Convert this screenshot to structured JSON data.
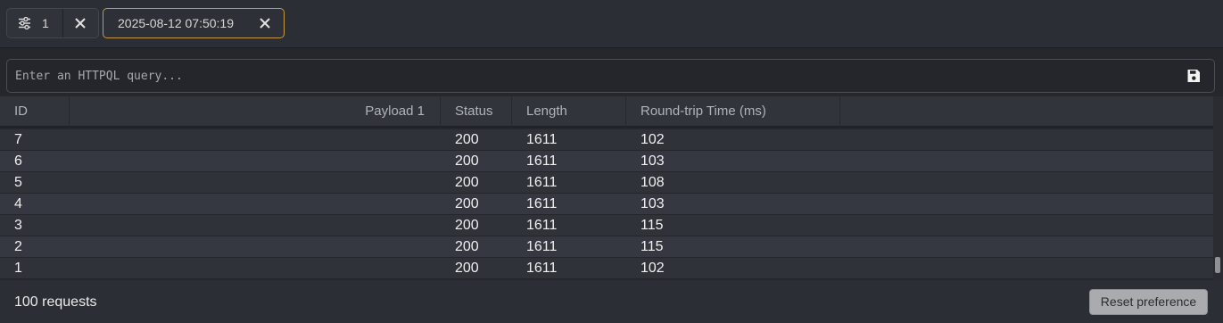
{
  "tabs": [
    {
      "icon": "filter-sliders-icon",
      "label": "1",
      "close_icon": "close-icon"
    },
    {
      "label": "2025-08-12 07:50:19",
      "close_icon": "close-icon",
      "active": true,
      "accent": "#c69a3e"
    }
  ],
  "query": {
    "placeholder": "Enter an HTTPQL query...",
    "value": "",
    "save_icon": "save-icon"
  },
  "table": {
    "columns": [
      "ID",
      "Payload 1",
      "Status",
      "Length",
      "Round-trip Time (ms)"
    ],
    "rows": [
      {
        "id": "7",
        "payload": "",
        "status": "200",
        "length": "1611",
        "rtt": "102"
      },
      {
        "id": "6",
        "payload": "",
        "status": "200",
        "length": "1611",
        "rtt": "103"
      },
      {
        "id": "5",
        "payload": "",
        "status": "200",
        "length": "1611",
        "rtt": "108"
      },
      {
        "id": "4",
        "payload": "",
        "status": "200",
        "length": "1611",
        "rtt": "103"
      },
      {
        "id": "3",
        "payload": "",
        "status": "200",
        "length": "1611",
        "rtt": "115"
      },
      {
        "id": "2",
        "payload": "",
        "status": "200",
        "length": "1611",
        "rtt": "115"
      },
      {
        "id": "1",
        "payload": "",
        "status": "200",
        "length": "1611",
        "rtt": "102"
      }
    ]
  },
  "footer": {
    "count": "100 requests",
    "reset_label": "Reset preference"
  }
}
